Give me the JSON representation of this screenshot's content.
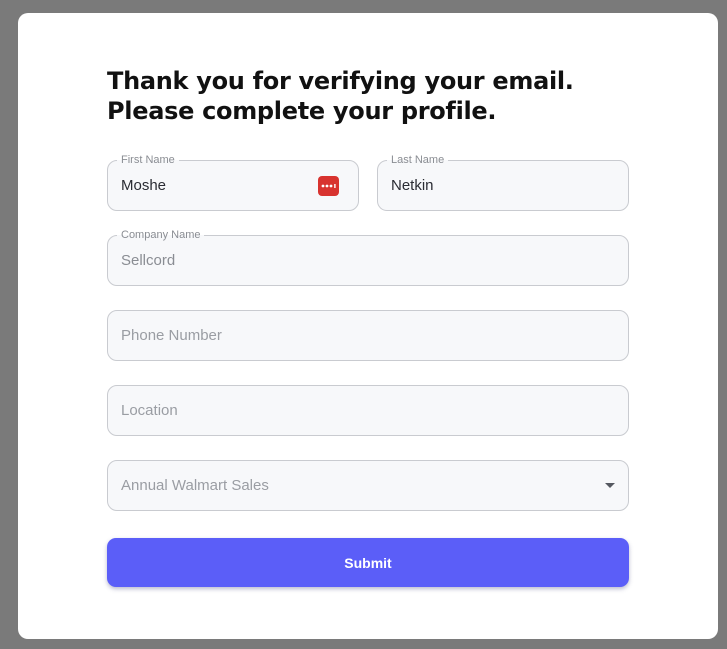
{
  "heading": {
    "line1": "Thank you for verifying your email.",
    "line2": "Please complete your profile."
  },
  "fields": {
    "first_name": {
      "label": "First Name",
      "value": "Moshe",
      "icon": "password-manager-icon"
    },
    "last_name": {
      "label": "Last Name",
      "value": "Netkin"
    },
    "company_name": {
      "label": "Company Name",
      "value": "Sellcord"
    },
    "phone_number": {
      "placeholder": "Phone Number"
    },
    "location": {
      "placeholder": "Location"
    },
    "annual_sales": {
      "placeholder": "Annual Walmart Sales",
      "icon": "chevron-down-icon"
    }
  },
  "submit": {
    "label": "Submit"
  },
  "colors": {
    "backdrop": "#7a7a7a",
    "card": "#ffffff",
    "field_bg": "#f7f8fa",
    "field_border": "#c9cbd0",
    "accent": "#5b5ef8",
    "password_manager": "#d8332f"
  }
}
